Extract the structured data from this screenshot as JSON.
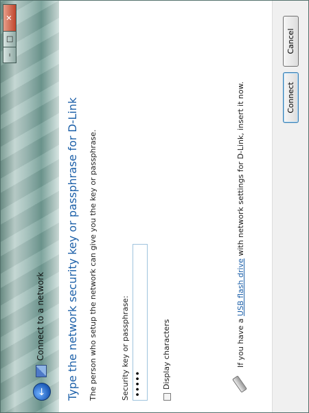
{
  "window": {
    "title": "Connect to a network",
    "controls": {
      "minimize": "–",
      "maximize": "□",
      "close": "✕"
    }
  },
  "main": {
    "heading": "Type the network security key or passphrase for D-Link",
    "subtext": "The person who setup the network can give you the key or passphrase.",
    "key_label": "Security key or passphrase:",
    "key_value": "•••••",
    "display_checkbox_label": "Display characters",
    "display_checkbox_checked": false,
    "usb": {
      "prefix": "If you have a ",
      "link": "USB flash drive",
      "suffix": " with network settings for D-Link, insert it now."
    }
  },
  "footer": {
    "connect_label": "Connect",
    "cancel_label": "Cancel"
  },
  "icons": {
    "back": "back-arrow-icon",
    "network": "network-icon",
    "usb": "usb-drive-icon"
  },
  "colors": {
    "heading": "#1b5fa8",
    "link": "#1b5fa8",
    "titlebar": "#9fbdb8"
  }
}
